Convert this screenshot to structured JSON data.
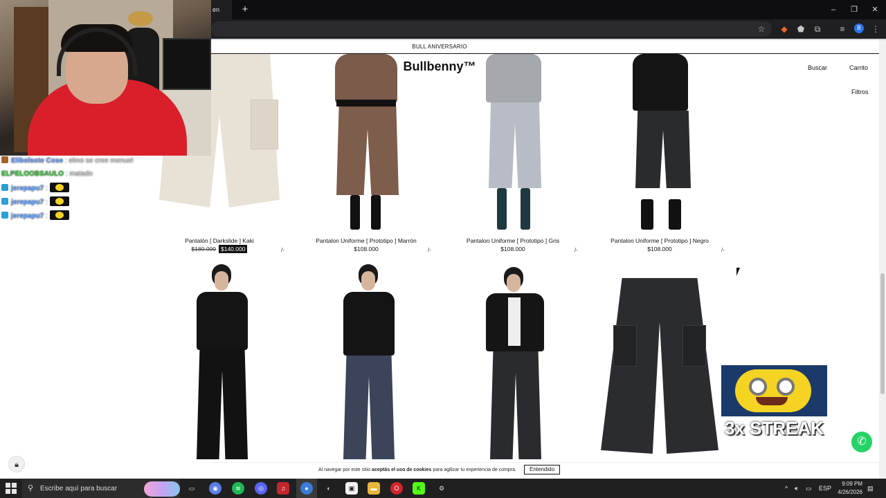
{
  "browser": {
    "tab_title": "en",
    "new_tab_symbol": "+",
    "window_controls": {
      "minimize": "–",
      "restore": "❐",
      "close": "✕"
    },
    "profile_initial": "B"
  },
  "site": {
    "announcement": "BULL ANIVERSARIO",
    "brand": "Bullbenny™",
    "nav": {
      "search": "Buscar",
      "cart": "Carrito",
      "filters": "Filtros"
    }
  },
  "products_row1": [
    {
      "name": "Pantalón [ Darkslide ] Kaki",
      "old_price": "$180.000",
      "price": "$140.000",
      "wish": "/-"
    },
    {
      "name": "Pantalon Uniforme [ Prototipo ] Marrón",
      "price": "$108.000",
      "wish": "/-"
    },
    {
      "name": "Pantalon Uniforme [ Prototipo ] Gris",
      "price": "$108.000",
      "wish": "/-"
    },
    {
      "name": "Pantalon Uniforme [ Prototipo ] Negro",
      "price": "$108.000",
      "wish": "/-"
    }
  ],
  "chat": [
    {
      "name": "Elibolsote Cose",
      "message": ": elmo se cree menuel",
      "color": "#7aa7ff"
    },
    {
      "name": "ELPELOOBSAULO",
      "message": ": matado",
      "color": "#3ec93e"
    },
    {
      "name": "jerepapu7",
      "message": ":",
      "color": "#6ea8ff"
    },
    {
      "name": "jerepapu7",
      "message": ":",
      "color": "#6ea8ff"
    },
    {
      "name": "jerepapu7",
      "message": ":",
      "color": "#6ea8ff"
    }
  ],
  "overlay": {
    "streak_text": "3x STREAK"
  },
  "cookie": {
    "text_before": "Al navegar por este sitio ",
    "text_bold": "aceptás el uso de cookies",
    "text_after": " para agilizar tu experiencia de compra.",
    "button": "Entendido"
  },
  "taskbar": {
    "search_placeholder": "Escribe aquí para buscar",
    "language": "ESP",
    "time": "9:09 PM",
    "date": "4/26/2026"
  },
  "colors": {
    "accent_whatsapp": "#25d366",
    "taskbar_bg": "#202020",
    "chrome_bg": "#1f1f22"
  }
}
